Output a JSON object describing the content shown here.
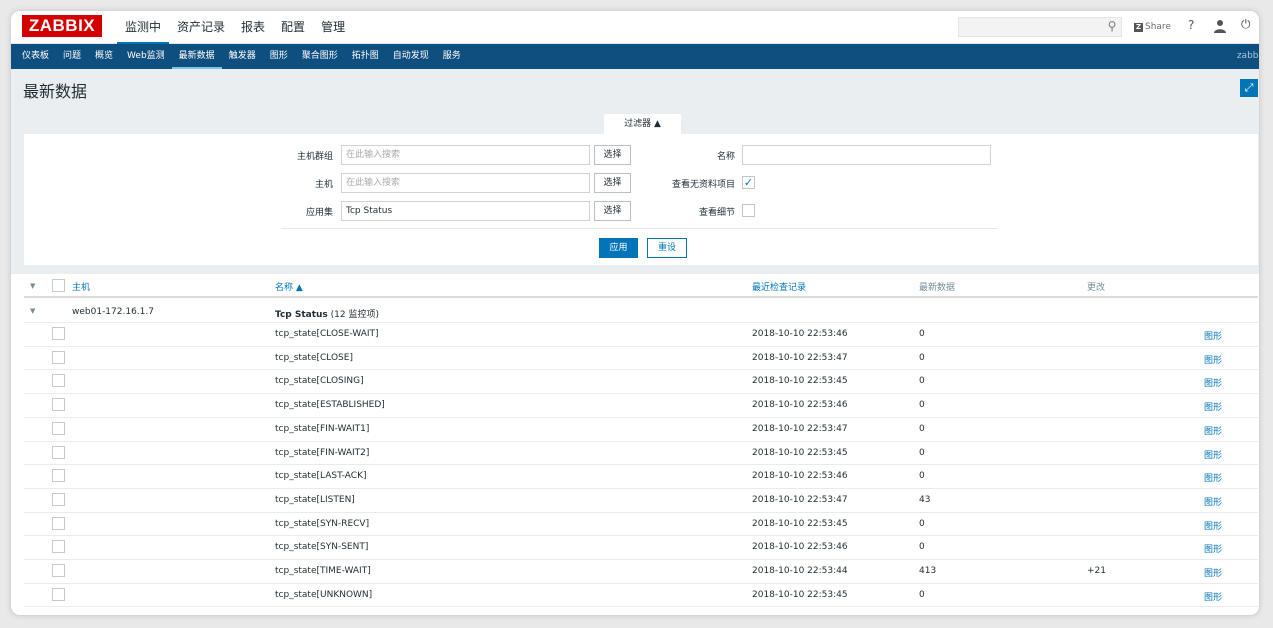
{
  "logo": "ZABBIX",
  "top_menu": [
    "监测中",
    "资产记录",
    "报表",
    "配置",
    "管理"
  ],
  "top_right": {
    "share_label": "Share",
    "help": "?"
  },
  "sub_nav": [
    "仪表板",
    "问题",
    "概览",
    "Web监测",
    "最新数据",
    "触发器",
    "图形",
    "聚合图形",
    "拓扑图",
    "自动发现",
    "服务"
  ],
  "sub_nav_active": "最新数据",
  "sub_nav_right": "zabbi",
  "page_title": "最新数据",
  "filter": {
    "tab_label": "过滤器 ▲",
    "host_group_label": "主机群组",
    "host_group_placeholder": "在此输入搜索",
    "host_label": "主机",
    "host_placeholder": "在此输入搜索",
    "app_label": "应用集",
    "app_value": "Tcp Status",
    "select_label": "选择",
    "name_label": "名称",
    "name_value": "",
    "show_no_data_label": "查看无资料项目",
    "show_no_data_checked": true,
    "show_details_label": "查看细节",
    "show_details_checked": false,
    "apply_label": "应用",
    "reset_label": "重设"
  },
  "table": {
    "headers": {
      "host": "主机",
      "name": "名称 ▲",
      "last_check": "最近检查记录",
      "last_value": "最新数据",
      "change": "更改"
    },
    "group": {
      "host": "web01-172.16.1.7",
      "app": "Tcp Status",
      "app_count": "(12 监控项)"
    },
    "rows": [
      {
        "name": "tcp_state[CLOSE-WAIT]",
        "time": "2018-10-10 22:53:46",
        "value": "0",
        "change": "",
        "action": "图形"
      },
      {
        "name": "tcp_state[CLOSE]",
        "time": "2018-10-10 22:53:47",
        "value": "0",
        "change": "",
        "action": "图形"
      },
      {
        "name": "tcp_state[CLOSING]",
        "time": "2018-10-10 22:53:45",
        "value": "0",
        "change": "",
        "action": "图形"
      },
      {
        "name": "tcp_state[ESTABLISHED]",
        "time": "2018-10-10 22:53:46",
        "value": "0",
        "change": "",
        "action": "图形"
      },
      {
        "name": "tcp_state[FIN-WAIT1]",
        "time": "2018-10-10 22:53:47",
        "value": "0",
        "change": "",
        "action": "图形"
      },
      {
        "name": "tcp_state[FIN-WAIT2]",
        "time": "2018-10-10 22:53:45",
        "value": "0",
        "change": "",
        "action": "图形"
      },
      {
        "name": "tcp_state[LAST-ACK]",
        "time": "2018-10-10 22:53:46",
        "value": "0",
        "change": "",
        "action": "图形"
      },
      {
        "name": "tcp_state[LISTEN]",
        "time": "2018-10-10 22:53:47",
        "value": "43",
        "change": "",
        "action": "图形"
      },
      {
        "name": "tcp_state[SYN-RECV]",
        "time": "2018-10-10 22:53:45",
        "value": "0",
        "change": "",
        "action": "图形"
      },
      {
        "name": "tcp_state[SYN-SENT]",
        "time": "2018-10-10 22:53:46",
        "value": "0",
        "change": "",
        "action": "图形"
      },
      {
        "name": "tcp_state[TIME-WAIT]",
        "time": "2018-10-10 22:53:44",
        "value": "413",
        "change": "+21",
        "action": "图形"
      },
      {
        "name": "tcp_state[UNKNOWN]",
        "time": "2018-10-10 22:53:45",
        "value": "0",
        "change": "",
        "action": "图形"
      }
    ]
  },
  "colors": {
    "brand_red": "#d40000",
    "nav_blue": "#0f4f7f",
    "link_blue": "#0275b8"
  }
}
